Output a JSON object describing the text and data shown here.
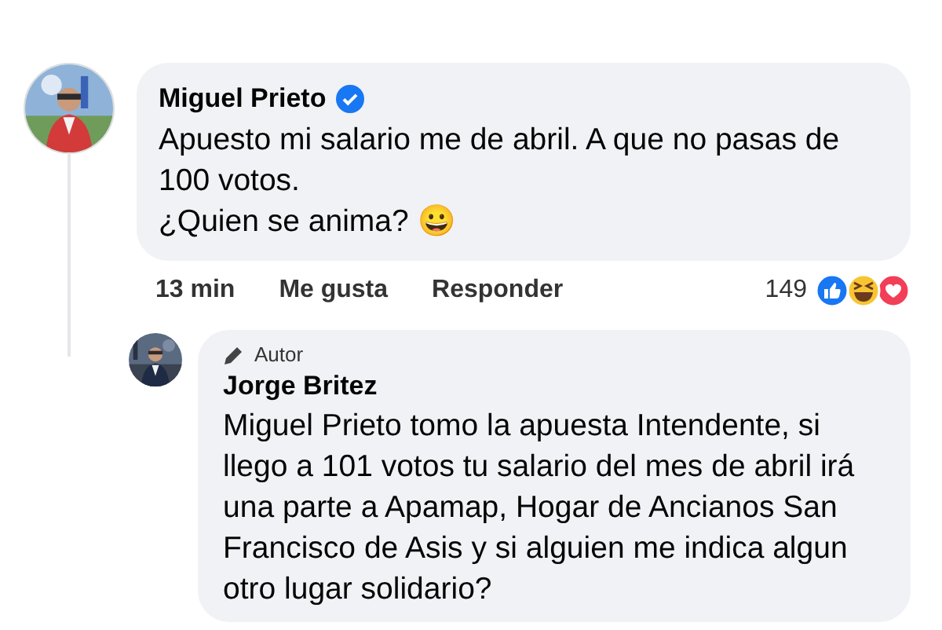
{
  "comment": {
    "author": "Miguel Prieto",
    "verified": true,
    "paragraphs": [
      "Apuesto mi salario me de abril. A que no pasas de 100 votos.",
      "¿Quien se anima? 😀"
    ],
    "time": "13 min",
    "actions": [
      "Me gusta",
      "Responder"
    ],
    "reaction_count": "149"
  },
  "reply": {
    "badge": "Autor",
    "author": "Jorge Britez",
    "text": "Miguel Prieto tomo la apuesta Intendente, si llego a 101 votos tu salario del mes de abril irá una parte a Apamap, Hogar de Ancianos San Francisco de Asis y si alguien me indica algun otro lugar solidario?"
  }
}
